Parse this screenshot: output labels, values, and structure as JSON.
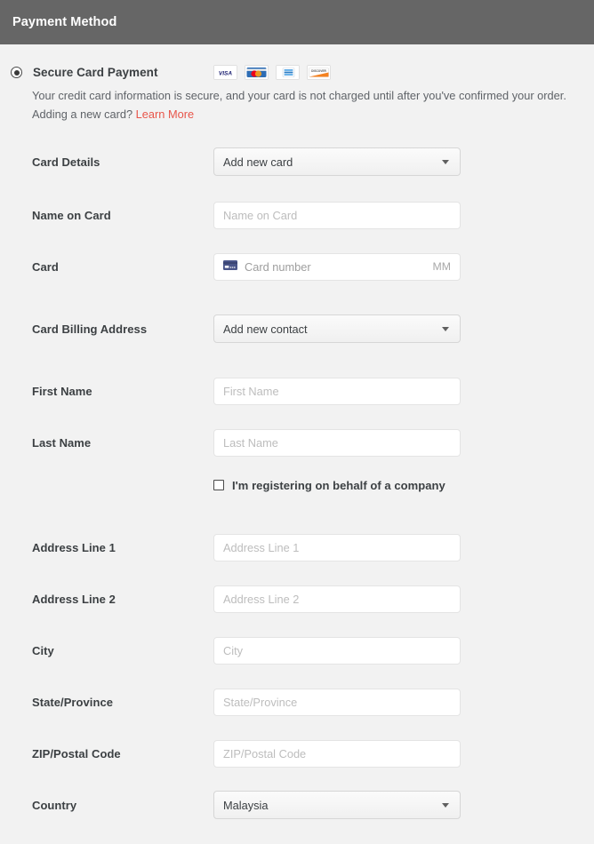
{
  "header": {
    "title": "Payment Method"
  },
  "payment_method": {
    "option_label": "Secure Card Payment",
    "selected": true,
    "accepted_cards": [
      {
        "name": "visa-card-icon",
        "label": "VISA"
      },
      {
        "name": "mastercard-card-icon",
        "label": "MasterCard"
      },
      {
        "name": "amex-card-icon",
        "label": "American Express"
      },
      {
        "name": "discover-card-icon",
        "label": "Discover"
      }
    ],
    "description_before": "Your credit card information is secure, and your card is not charged until after you've confirmed your order. Adding a new card? ",
    "learn_more_label": "Learn More",
    "learn_more_color": "#e8554a"
  },
  "form": {
    "card_details": {
      "label": "Card Details",
      "value": "Add new card",
      "options": [
        "Add new card"
      ]
    },
    "name_on_card": {
      "label": "Name on Card",
      "value": "",
      "placeholder": "Name on Card"
    },
    "card": {
      "label": "Card",
      "number_placeholder": "Card number",
      "expiry_placeholder": "MM",
      "icon": "credit-card-icon"
    },
    "card_billing_address": {
      "label": "Card Billing Address",
      "value": "Add new contact",
      "options": [
        "Add new contact"
      ]
    },
    "first_name": {
      "label": "First Name",
      "value": "",
      "placeholder": "First Name"
    },
    "last_name": {
      "label": "Last Name",
      "value": "",
      "placeholder": "Last Name"
    },
    "company_checkbox": {
      "label": "I'm registering on behalf of a company",
      "checked": false
    },
    "address_line_1": {
      "label": "Address Line 1",
      "value": "",
      "placeholder": "Address Line 1"
    },
    "address_line_2": {
      "label": "Address Line 2",
      "value": "",
      "placeholder": "Address Line 2"
    },
    "city": {
      "label": "City",
      "value": "",
      "placeholder": "City"
    },
    "state_province": {
      "label": "State/Province",
      "value": "",
      "placeholder": "State/Province"
    },
    "zip_postal_code": {
      "label": "ZIP/Postal Code",
      "value": "",
      "placeholder": "ZIP/Postal Code"
    },
    "country": {
      "label": "Country",
      "value": "Malaysia",
      "options": [
        "Malaysia"
      ]
    }
  },
  "theme": {
    "header_bg": "#666666",
    "page_bg": "#f2f2f2",
    "label_color": "#3c4043",
    "placeholder_color": "#bdbdbd",
    "link_color": "#e8554a"
  }
}
